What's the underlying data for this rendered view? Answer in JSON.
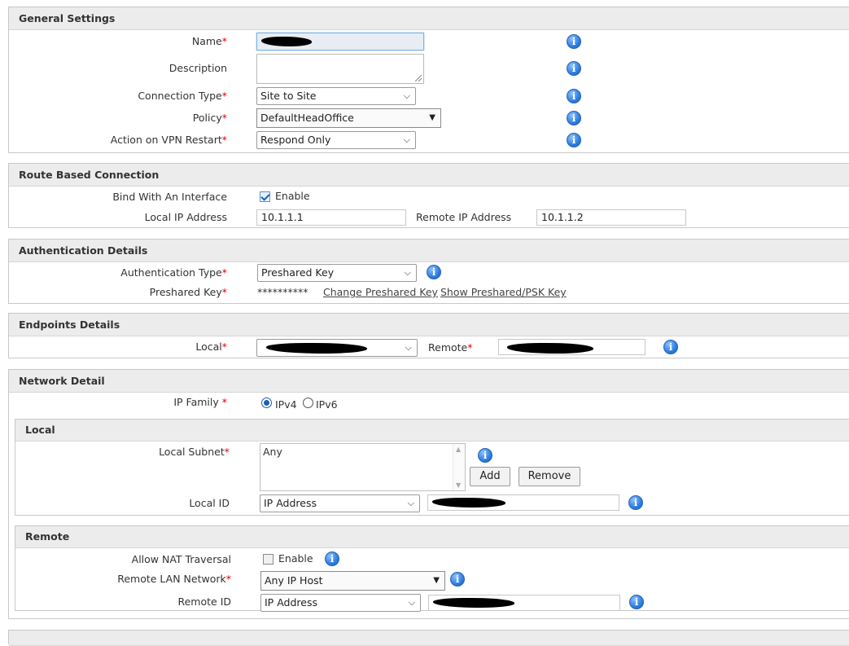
{
  "general": {
    "title": "General Settings",
    "name_label": "Name",
    "description_label": "Description",
    "conn_type_label": "Connection Type",
    "conn_type_value": "Site to Site",
    "policy_label": "Policy",
    "policy_value": "DefaultHeadOffice",
    "action_label": "Action on VPN Restart",
    "action_value": "Respond Only"
  },
  "route": {
    "title": "Route Based Connection",
    "bind_label": "Bind With An Interface",
    "bind_checked": true,
    "enable_label": "Enable",
    "local_ip_label": "Local IP Address",
    "local_ip_value": "10.1.1.1",
    "remote_ip_label": "Remote IP Address",
    "remote_ip_value": "10.1.1.2"
  },
  "auth": {
    "title": "Authentication Details",
    "type_label": "Authentication Type",
    "type_value": "Preshared Key",
    "key_label": "Preshared Key",
    "key_masked": "**********",
    "change_link": "Change Preshared Key",
    "show_link": "Show Preshared/PSK Key"
  },
  "endpoints": {
    "title": "Endpoints Details",
    "local_label": "Local",
    "remote_label": "Remote"
  },
  "network": {
    "title": "Network Detail",
    "ip_family_label": "IP Family",
    "ipv4_label": "IPv4",
    "ipv6_label": "IPv6",
    "selected_family": "IPv4",
    "local": {
      "title": "Local",
      "subnet_label": "Local Subnet",
      "subnets": [
        "Any"
      ],
      "add_button": "Add",
      "remove_button": "Remove",
      "local_id_label": "Local ID",
      "local_id_type": "IP Address"
    },
    "remote": {
      "title": "Remote",
      "nat_label": "Allow NAT Traversal",
      "nat_checked": false,
      "nat_enable_label": "Enable",
      "lan_label": "Remote LAN Network",
      "lan_value": "Any IP Host",
      "remote_id_label": "Remote ID",
      "remote_id_type": "IP Address"
    }
  },
  "icons": {
    "info": "info-icon",
    "required_marker": "*"
  },
  "colors": {
    "required": "#dd0000",
    "info_blue": "#2d7ee0",
    "section_header": "#ececec"
  }
}
